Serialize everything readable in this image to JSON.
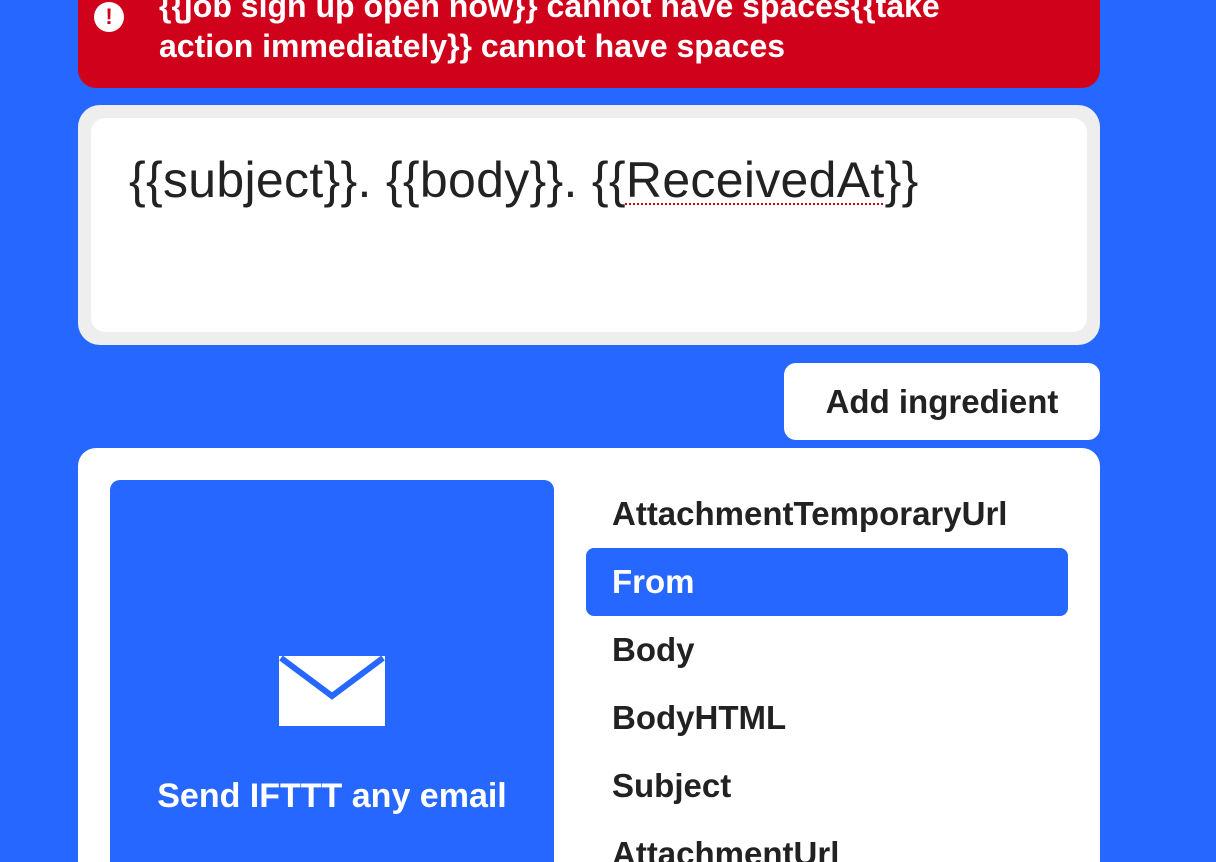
{
  "error_banner": {
    "icon": "exclamation-icon",
    "message": "{{job sign up open now}} cannot have spaces{{take\naction immediately}} cannot have spaces"
  },
  "text_field": {
    "part1": "{{subject}}. {{body}}. {{",
    "misspelled": "ReceivedAt",
    "part2": "}}"
  },
  "add_ingredient_button": {
    "label": "Add ingredient"
  },
  "service": {
    "icon": "envelope-icon",
    "label": "Send IFTTT any email"
  },
  "ingredients": [
    {
      "label": "AttachmentTemporaryUrl",
      "selected": false
    },
    {
      "label": "From",
      "selected": true
    },
    {
      "label": "Body",
      "selected": false
    },
    {
      "label": "BodyHTML",
      "selected": false
    },
    {
      "label": "Subject",
      "selected": false
    },
    {
      "label": "AttachmentUrl",
      "selected": false
    }
  ],
  "colors": {
    "background": "#2567ff",
    "error": "#d0021b",
    "selected": "#2567ff",
    "text": "#222222"
  }
}
